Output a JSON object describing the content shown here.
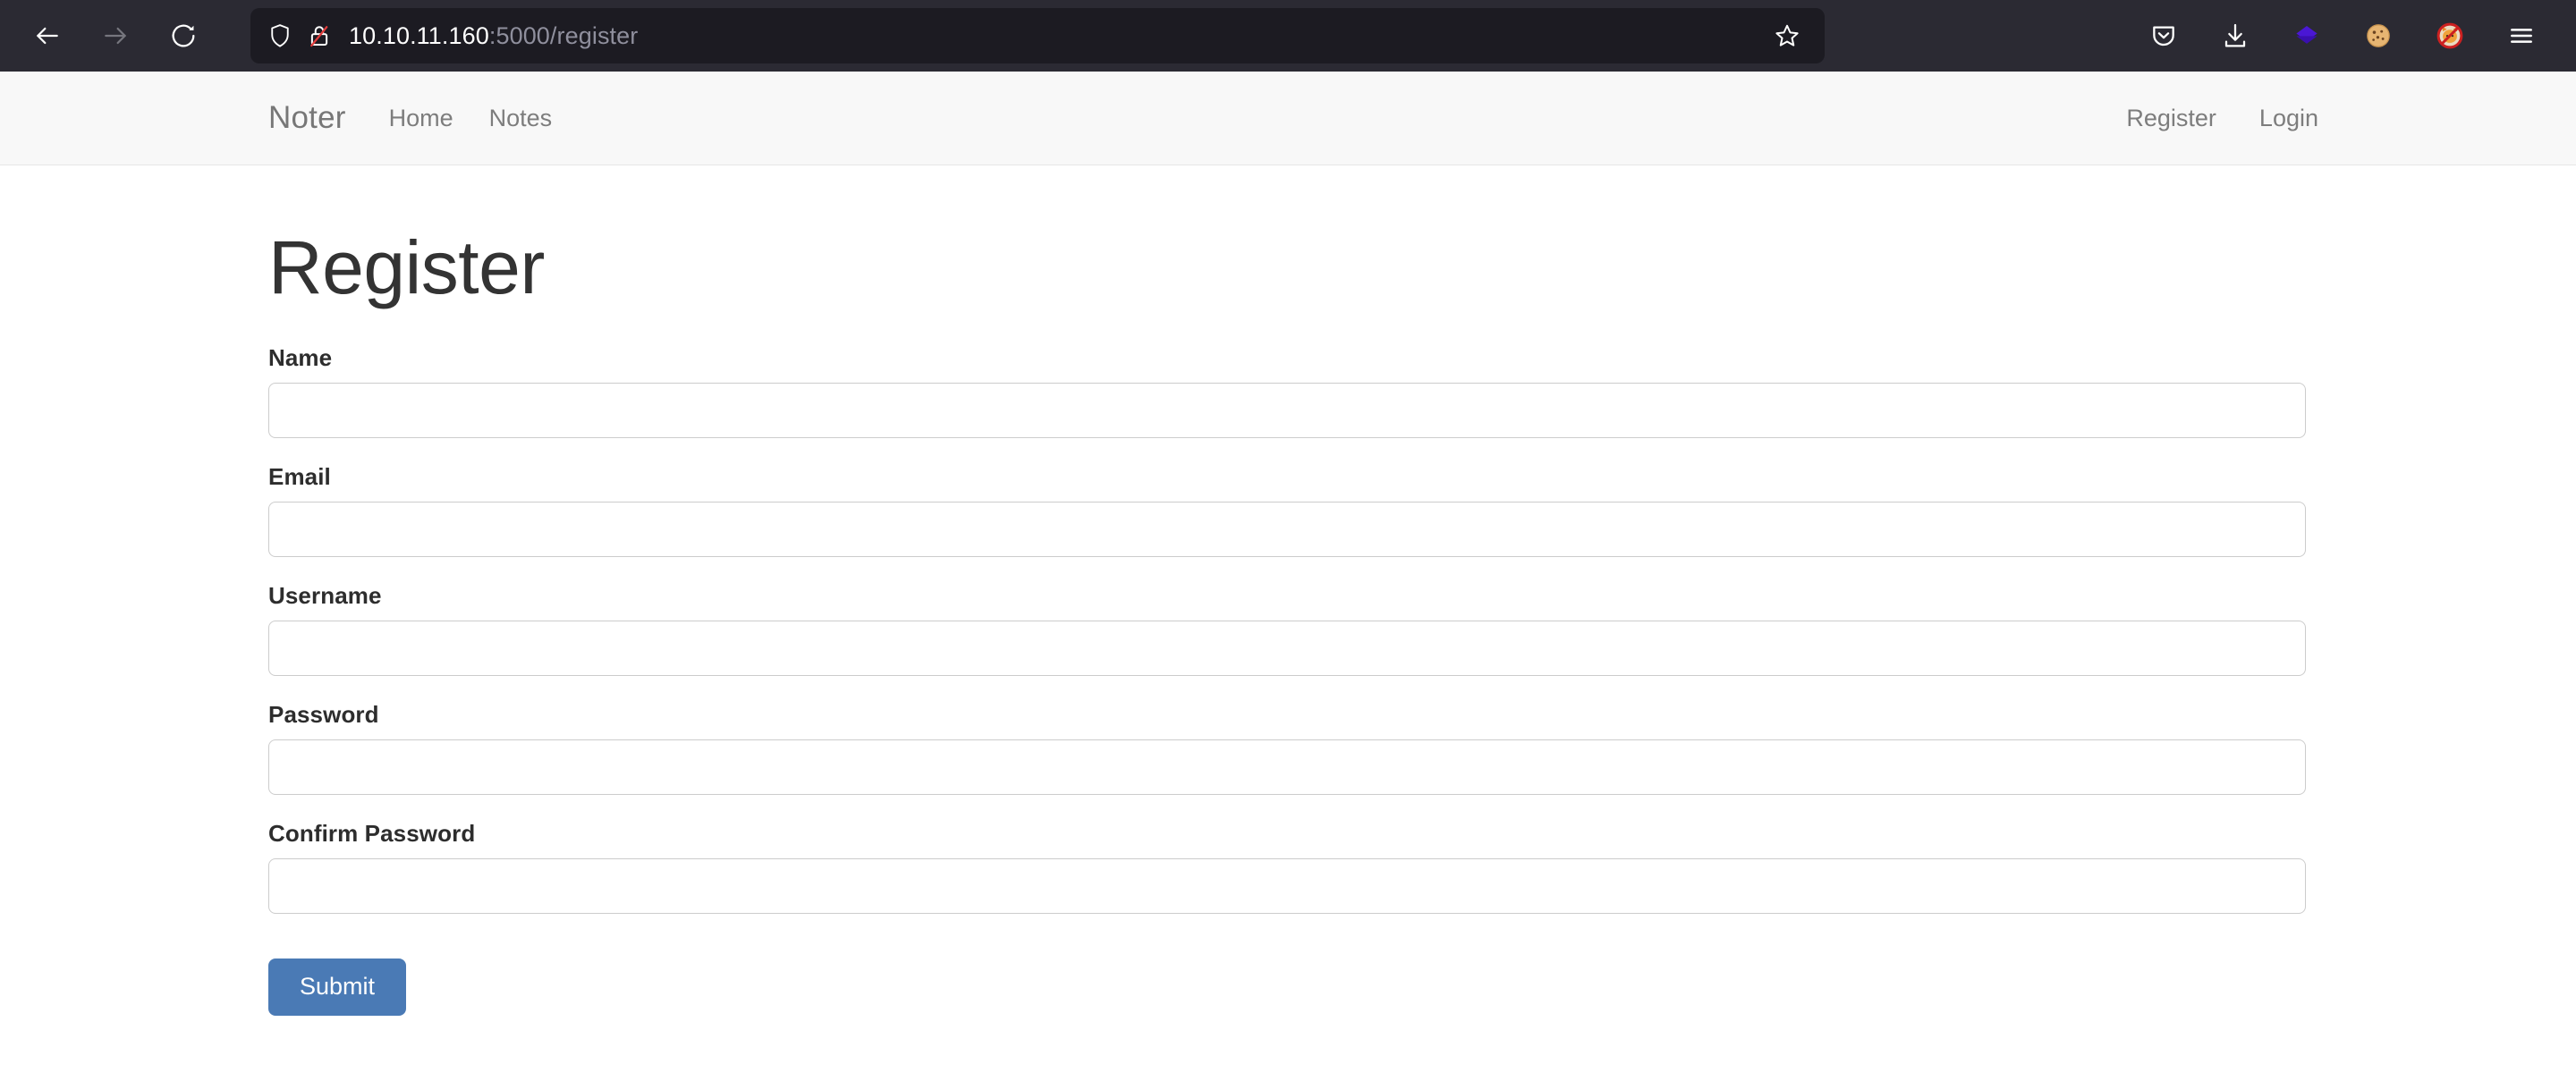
{
  "browser": {
    "back_label": "Back",
    "forward_label": "Forward",
    "reload_label": "Reload",
    "shield_label": "Tracking protection",
    "lock_label": "Connection is not secure",
    "url_host": "10.10.11.160",
    "url_rest": ":5000/register",
    "url_full": "10.10.11.160:5000/register",
    "bookmark_label": "Bookmark this page",
    "toolbar_icons": [
      {
        "name": "pocket-icon",
        "glyph": ""
      },
      {
        "name": "downloads-icon",
        "glyph": ""
      },
      {
        "name": "wappalyzer-icon",
        "glyph": ""
      },
      {
        "name": "cookie-manager-icon",
        "glyph": "🍪"
      },
      {
        "name": "foxyproxy-disabled-icon",
        "glyph": ""
      },
      {
        "name": "app-menu-icon",
        "glyph": ""
      }
    ],
    "chrome_bg": "#2b2a33",
    "urlbar_bg": "#1c1b22"
  },
  "site": {
    "brand": "Noter",
    "nav_left": [
      {
        "label": "Home"
      },
      {
        "label": "Notes"
      }
    ],
    "nav_right": [
      {
        "label": "Register"
      },
      {
        "label": "Login"
      }
    ],
    "navbar_bg": "#f8f8f8"
  },
  "page": {
    "title": "Register",
    "accent_color": "#4a7ab5",
    "fields": [
      {
        "label": "Name",
        "name": "name",
        "type": "text",
        "value": "",
        "placeholder": ""
      },
      {
        "label": "Email",
        "name": "email",
        "type": "text",
        "value": "",
        "placeholder": ""
      },
      {
        "label": "Username",
        "name": "username",
        "type": "text",
        "value": "",
        "placeholder": ""
      },
      {
        "label": "Password",
        "name": "password",
        "type": "password",
        "value": "",
        "placeholder": ""
      },
      {
        "label": "Confirm Password",
        "name": "confirm_password",
        "type": "password",
        "value": "",
        "placeholder": ""
      }
    ],
    "submit_label": "Submit"
  }
}
